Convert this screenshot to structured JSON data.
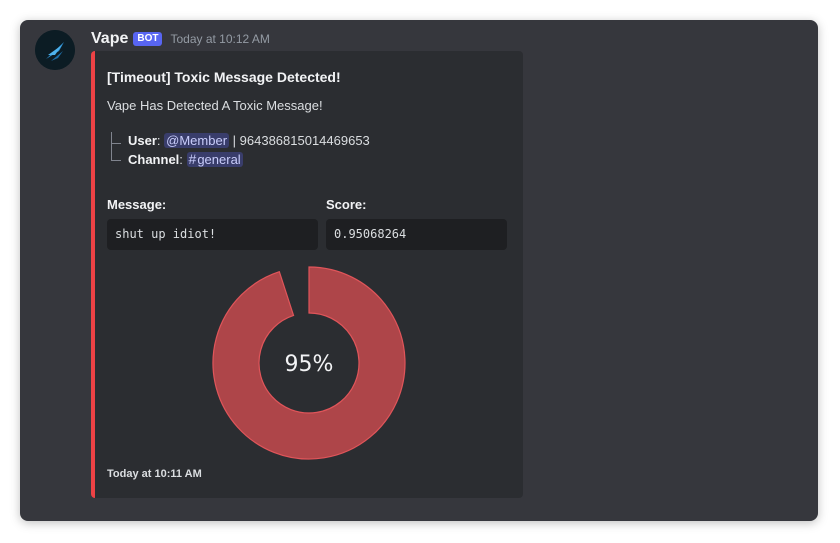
{
  "message": {
    "username": "Vape",
    "bot_tag": "BOT",
    "timestamp": "Today at 10:12 AM"
  },
  "embed": {
    "accent_color": "#ed4245",
    "title": "[Timeout] Toxic Message Detected!",
    "description": "Vape Has Detected A Toxic Message!",
    "user_label": "User",
    "user_mention": "@Member",
    "user_id": "| 964386815014469653",
    "channel_label": "Channel",
    "channel_mention": "general",
    "fields": [
      {
        "name": "Message:",
        "value": "shut up idiot!"
      },
      {
        "name": "Score:",
        "value": "0.95068264"
      }
    ],
    "gauge": {
      "label": "95%",
      "fraction": 0.95,
      "color": "#ae4549"
    },
    "footer": "Today at 10:11 AM"
  }
}
